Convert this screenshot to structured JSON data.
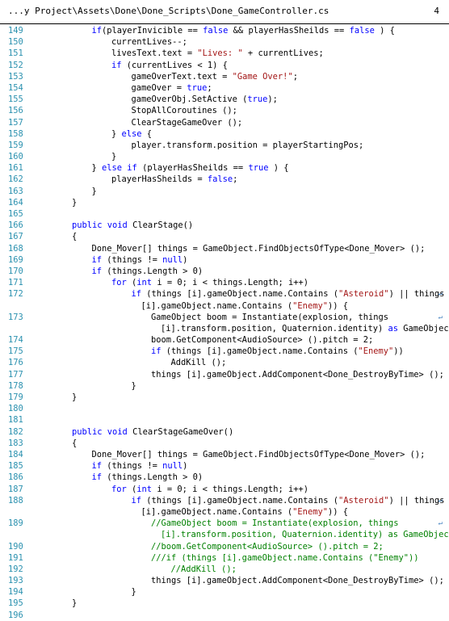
{
  "header": {
    "file_path": "...y Project\\Assets\\Done\\Done_Scripts\\Done_GameController.cs",
    "page_number": "4"
  },
  "continuation_marker": "↵",
  "lines": [
    {
      "n": "149",
      "indent": 3,
      "segs": [
        [
          "kw",
          "if"
        ],
        [
          "",
          "(playerInvicible == "
        ],
        [
          "kw",
          "false"
        ],
        [
          "",
          " && playerHasSheilds == "
        ],
        [
          "kw",
          "false"
        ],
        [
          "",
          " ) {"
        ]
      ]
    },
    {
      "n": "150",
      "indent": 4,
      "segs": [
        [
          "",
          "currentLives--;"
        ]
      ]
    },
    {
      "n": "151",
      "indent": 4,
      "segs": [
        [
          "",
          "livesText.text = "
        ],
        [
          "str",
          "\"Lives: \""
        ],
        [
          "",
          " + currentLives;"
        ]
      ]
    },
    {
      "n": "152",
      "indent": 4,
      "segs": [
        [
          "kw",
          "if"
        ],
        [
          "",
          " (currentLives < 1) {"
        ]
      ]
    },
    {
      "n": "153",
      "indent": 5,
      "segs": [
        [
          "",
          "gameOverText.text = "
        ],
        [
          "str",
          "\"Game Over!\""
        ],
        [
          "",
          ";"
        ]
      ]
    },
    {
      "n": "154",
      "indent": 5,
      "segs": [
        [
          "",
          "gameOver = "
        ],
        [
          "kw",
          "true"
        ],
        [
          "",
          ";"
        ]
      ]
    },
    {
      "n": "155",
      "indent": 5,
      "segs": [
        [
          "",
          "gameOverObj.SetActive ("
        ],
        [
          "kw",
          "true"
        ],
        [
          "",
          ");"
        ]
      ]
    },
    {
      "n": "156",
      "indent": 5,
      "segs": [
        [
          "",
          "StopAllCoroutines ();"
        ]
      ]
    },
    {
      "n": "157",
      "indent": 5,
      "segs": [
        [
          "",
          "ClearStageGameOver ();"
        ]
      ]
    },
    {
      "n": "158",
      "indent": 4,
      "segs": [
        [
          "",
          "} "
        ],
        [
          "kw",
          "else"
        ],
        [
          "",
          " {"
        ]
      ]
    },
    {
      "n": "159",
      "indent": 5,
      "segs": [
        [
          "",
          "player.transform.position = playerStartingPos;"
        ]
      ]
    },
    {
      "n": "160",
      "indent": 4,
      "segs": [
        [
          "",
          "}"
        ]
      ]
    },
    {
      "n": "161",
      "indent": 3,
      "segs": [
        [
          "",
          "} "
        ],
        [
          "kw",
          "else if"
        ],
        [
          "",
          " (playerHasSheilds == "
        ],
        [
          "kw",
          "true"
        ],
        [
          "",
          " ) {"
        ]
      ]
    },
    {
      "n": "162",
      "indent": 4,
      "segs": [
        [
          "",
          "playerHasSheilds = "
        ],
        [
          "kw",
          "false"
        ],
        [
          "",
          ";"
        ]
      ]
    },
    {
      "n": "163",
      "indent": 3,
      "segs": [
        [
          "",
          "}"
        ]
      ]
    },
    {
      "n": "164",
      "indent": 2,
      "segs": [
        [
          "",
          "}"
        ]
      ]
    },
    {
      "n": "165",
      "indent": 0,
      "segs": []
    },
    {
      "n": "166",
      "indent": 2,
      "segs": [
        [
          "kw",
          "public void"
        ],
        [
          "",
          " ClearStage()"
        ]
      ]
    },
    {
      "n": "167",
      "indent": 2,
      "segs": [
        [
          "",
          "{"
        ]
      ]
    },
    {
      "n": "168",
      "indent": 3,
      "segs": [
        [
          "",
          "Done_Mover[] things = GameObject.FindObjectsOfType<Done_Mover> ();"
        ]
      ]
    },
    {
      "n": "169",
      "indent": 3,
      "segs": [
        [
          "kw",
          "if"
        ],
        [
          "",
          " (things != "
        ],
        [
          "kw",
          "null"
        ],
        [
          "",
          ")"
        ]
      ]
    },
    {
      "n": "170",
      "indent": 3,
      "segs": [
        [
          "kw",
          "if"
        ],
        [
          "",
          " (things.Length > 0)"
        ]
      ]
    },
    {
      "n": "171",
      "indent": 4,
      "segs": [
        [
          "kw",
          "for"
        ],
        [
          "",
          " ("
        ],
        [
          "kw",
          "int"
        ],
        [
          "",
          " i = 0; i < things.Length; i++)"
        ]
      ]
    },
    {
      "n": "172",
      "indent": 5,
      "wrap": true,
      "segs": [
        [
          "kw",
          "if"
        ],
        [
          "",
          " (things [i].gameObject.name.Contains ("
        ],
        [
          "str",
          "\"Asteroid\""
        ],
        [
          "",
          ") || things"
        ]
      ],
      "cont_segs": [
        [
          "",
          "[i].gameObject.name.Contains ("
        ],
        [
          "str",
          "\"Enemy\""
        ],
        [
          "",
          ")) {"
        ]
      ]
    },
    {
      "n": "173",
      "indent": 6,
      "wrap": true,
      "segs": [
        [
          "",
          "GameObject boom = Instantiate(explosion, things"
        ]
      ],
      "cont_segs": [
        [
          "",
          "[i].transform.position, Quaternion.identity) "
        ],
        [
          "kw",
          "as"
        ],
        [
          "",
          " GameObject;"
        ]
      ]
    },
    {
      "n": "174",
      "indent": 6,
      "segs": [
        [
          "",
          "boom.GetComponent<AudioSource> ().pitch = 2;"
        ]
      ]
    },
    {
      "n": "175",
      "indent": 6,
      "segs": [
        [
          "kw",
          "if"
        ],
        [
          "",
          " (things [i].gameObject.name.Contains ("
        ],
        [
          "str",
          "\"Enemy\""
        ],
        [
          "",
          "))"
        ]
      ]
    },
    {
      "n": "176",
      "indent": 7,
      "segs": [
        [
          "",
          "AddKill ();"
        ]
      ]
    },
    {
      "n": "177",
      "indent": 6,
      "segs": [
        [
          "",
          "things [i].gameObject.AddComponent<Done_DestroyByTime> ();"
        ]
      ]
    },
    {
      "n": "178",
      "indent": 5,
      "segs": [
        [
          "",
          "}"
        ]
      ]
    },
    {
      "n": "179",
      "indent": 2,
      "segs": [
        [
          "",
          "}"
        ]
      ]
    },
    {
      "n": "180",
      "indent": 0,
      "segs": []
    },
    {
      "n": "181",
      "indent": 0,
      "segs": []
    },
    {
      "n": "182",
      "indent": 2,
      "segs": [
        [
          "kw",
          "public void"
        ],
        [
          "",
          " ClearStageGameOver()"
        ]
      ]
    },
    {
      "n": "183",
      "indent": 2,
      "segs": [
        [
          "",
          "{"
        ]
      ]
    },
    {
      "n": "184",
      "indent": 3,
      "segs": [
        [
          "",
          "Done_Mover[] things = GameObject.FindObjectsOfType<Done_Mover> ();"
        ]
      ]
    },
    {
      "n": "185",
      "indent": 3,
      "segs": [
        [
          "kw",
          "if"
        ],
        [
          "",
          " (things != "
        ],
        [
          "kw",
          "null"
        ],
        [
          "",
          ")"
        ]
      ]
    },
    {
      "n": "186",
      "indent": 3,
      "segs": [
        [
          "kw",
          "if"
        ],
        [
          "",
          " (things.Length > 0)"
        ]
      ]
    },
    {
      "n": "187",
      "indent": 4,
      "segs": [
        [
          "kw",
          "for"
        ],
        [
          "",
          " ("
        ],
        [
          "kw",
          "int"
        ],
        [
          "",
          " i = 0; i < things.Length; i++)"
        ]
      ]
    },
    {
      "n": "188",
      "indent": 5,
      "wrap": true,
      "segs": [
        [
          "kw",
          "if"
        ],
        [
          "",
          " (things [i].gameObject.name.Contains ("
        ],
        [
          "str",
          "\"Asteroid\""
        ],
        [
          "",
          ") || things"
        ]
      ],
      "cont_segs": [
        [
          "",
          "[i].gameObject.name.Contains ("
        ],
        [
          "str",
          "\"Enemy\""
        ],
        [
          "",
          ")) {"
        ]
      ]
    },
    {
      "n": "189",
      "indent": 6,
      "wrap": true,
      "segs": [
        [
          "cm",
          "//GameObject boom = Instantiate(explosion, things"
        ]
      ],
      "cont_segs": [
        [
          "cm",
          "[i].transform.position, Quaternion.identity) as GameObject;"
        ]
      ]
    },
    {
      "n": "190",
      "indent": 6,
      "segs": [
        [
          "cm",
          "//boom.GetComponent<AudioSource> ().pitch = 2;"
        ]
      ]
    },
    {
      "n": "191",
      "indent": 6,
      "segs": [
        [
          "cm",
          "///if (things [i].gameObject.name.Contains (\"Enemy\"))"
        ]
      ]
    },
    {
      "n": "192",
      "indent": 7,
      "segs": [
        [
          "cm",
          "//AddKill ();"
        ]
      ]
    },
    {
      "n": "193",
      "indent": 6,
      "segs": [
        [
          "",
          "things [i].gameObject.AddComponent<Done_DestroyByTime> ();"
        ]
      ]
    },
    {
      "n": "194",
      "indent": 5,
      "segs": [
        [
          "",
          "}"
        ]
      ]
    },
    {
      "n": "195",
      "indent": 2,
      "segs": [
        [
          "",
          "}"
        ]
      ]
    },
    {
      "n": "196",
      "indent": 0,
      "segs": []
    }
  ]
}
